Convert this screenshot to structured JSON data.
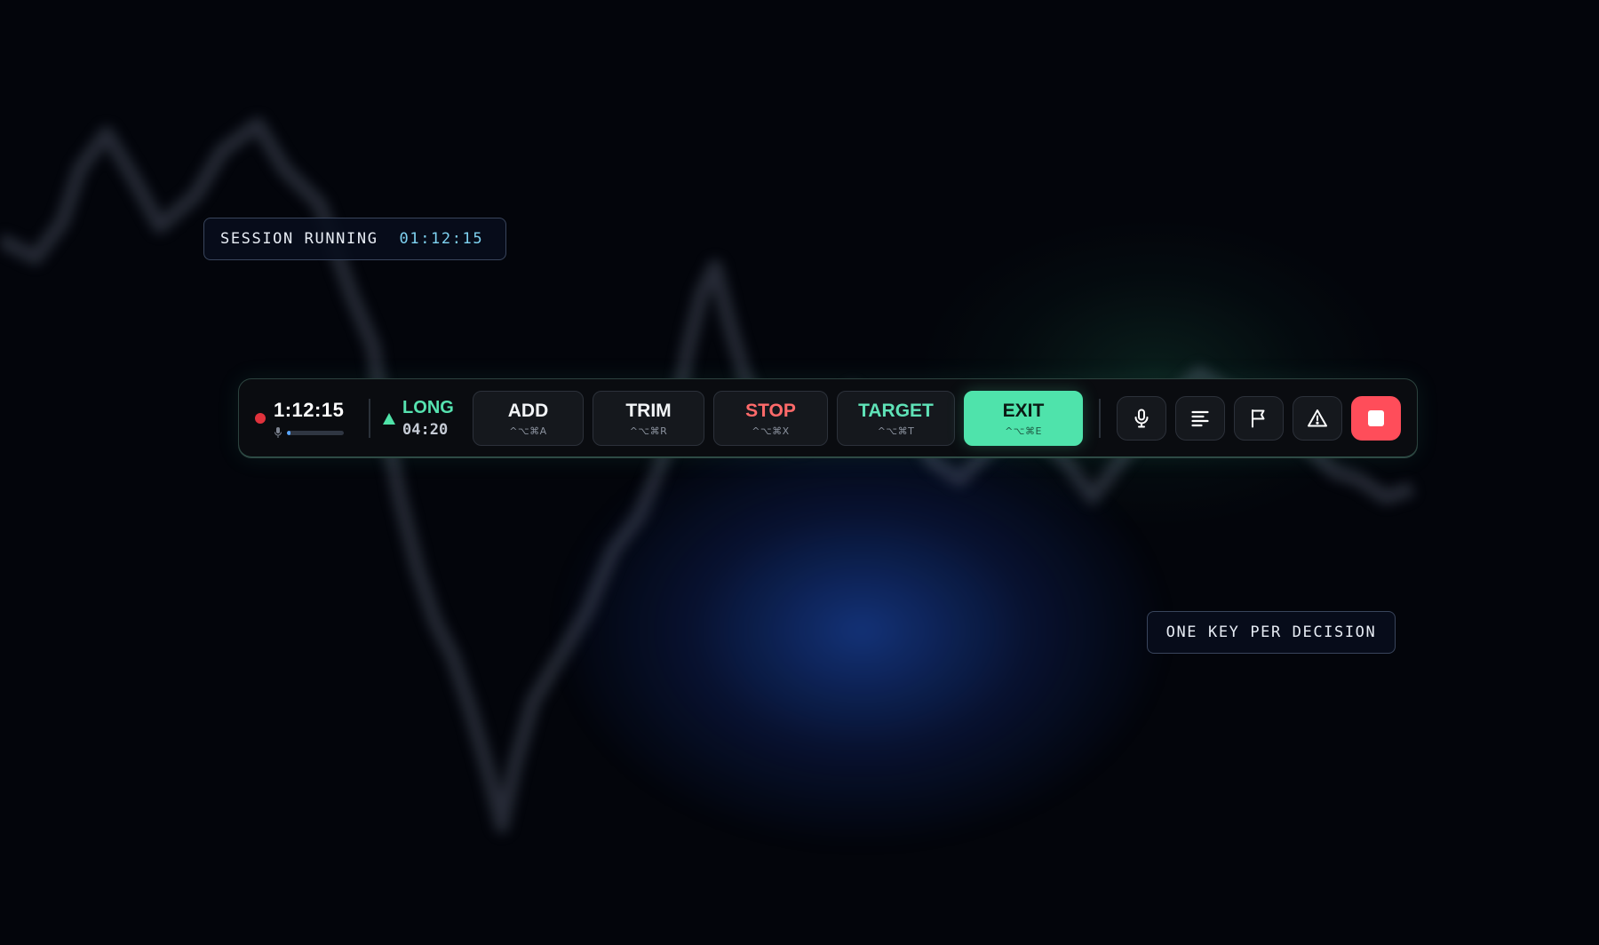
{
  "session_pill": {
    "label": "SESSION RUNNING",
    "elapsed": "01:12:15"
  },
  "toolbar": {
    "recording": {
      "elapsed": "1:12:15",
      "mic_level": 0.06
    },
    "position": {
      "side": "LONG",
      "duration": "04:20"
    },
    "actions": [
      {
        "label": "ADD",
        "shortcut": "^⌥⌘A"
      },
      {
        "label": "TRIM",
        "shortcut": "^⌥⌘R"
      },
      {
        "label": "STOP",
        "shortcut": "^⌥⌘X"
      },
      {
        "label": "TARGET",
        "shortcut": "^⌥⌘T"
      },
      {
        "label": "EXIT",
        "shortcut": "^⌥⌘E"
      }
    ],
    "icon_buttons": [
      "microphone-icon",
      "notes-icon",
      "flag-icon",
      "warning-icon",
      "stop-recording-icon"
    ]
  },
  "tagline": "ONE KEY PER DECISION",
  "colors": {
    "accent_green": "#4fe3ab",
    "stop_red": "#ff6a6a",
    "record_red": "#e0323c",
    "stop_button_red": "#ff4d5a",
    "time_cyan": "#7fd3f2"
  }
}
